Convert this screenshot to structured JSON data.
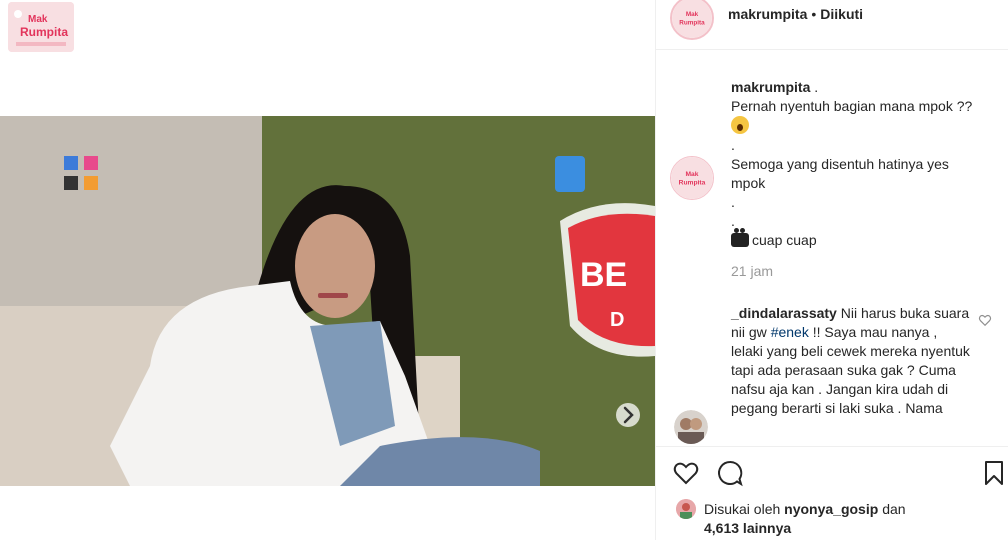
{
  "brand": {
    "logo_text": "Mak Rumpita",
    "accent": "#e2345b"
  },
  "video": {
    "sign_text": "BE",
    "sign_text2": "D"
  },
  "header": {
    "username": "makrumpita",
    "separator": "•",
    "follow_status": "Diikuti"
  },
  "caption": {
    "username": "makrumpita",
    "lines": [
      ".",
      "Pernah nyentuh bagian mana mpok ??",
      "",
      ".",
      "Semoga yang disentuh hatinya yes",
      "mpok",
      ".",
      ".",
      "cuap cuap"
    ],
    "time": "21 jam"
  },
  "comment": {
    "username": "_dindalarassaty",
    "text_before": " Nii harus buka suara nii gw ",
    "hashtag": "#enek",
    "text_after": " !! Saya mau nanya , lelaki yang beli cewek mereka nyentuk tapi ada perasaan suka gak ? Cuma nafsu aja kan . Jangan kira udah di pegang berarti si laki suka . Nama"
  },
  "likes": {
    "prefix": "Disukai oleh",
    "user": "nyonya_gosip",
    "conj": "dan",
    "count": "4,613 lainnya"
  },
  "icons": [
    "heart-icon",
    "comment-icon",
    "bookmark-icon",
    "chevron-right-icon"
  ]
}
